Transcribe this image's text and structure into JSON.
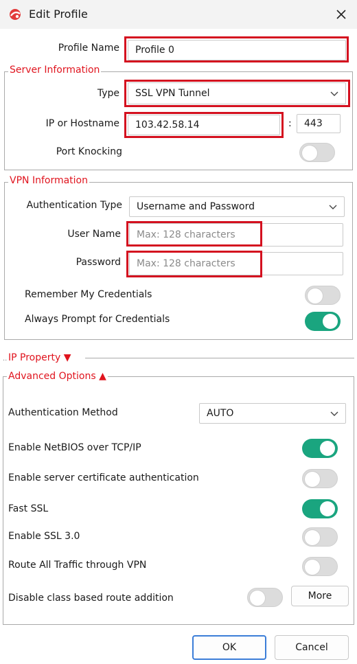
{
  "window": {
    "title": "Edit Profile"
  },
  "profile": {
    "name_label": "Profile Name",
    "name_value": "Profile 0"
  },
  "server": {
    "legend": "Server Information",
    "type_label": "Type",
    "type_value": "SSL VPN Tunnel",
    "host_label": "IP or Hostname",
    "host_value": "103.42.58.14",
    "port_sep": ":",
    "port_value": "443",
    "knock_label": "Port Knocking",
    "knock_on": false
  },
  "vpn": {
    "legend": "VPN Information",
    "auth_type_label": "Authentication Type",
    "auth_type_value": "Username and Password",
    "user_label": "User Name",
    "user_placeholder": "Max: 128 characters",
    "pass_label": "Password",
    "pass_placeholder": "Max: 128 characters",
    "remember_label": "Remember My Credentials",
    "remember_on": false,
    "prompt_label": "Always Prompt for Credentials",
    "prompt_on": true
  },
  "ip_property": {
    "label": "IP Property",
    "arrow": "▼"
  },
  "advanced": {
    "label": "Advanced Options",
    "arrow": "▲",
    "auth_method_label": "Authentication Method",
    "auth_method_value": "AUTO",
    "netbios_label": "Enable NetBIOS over TCP/IP",
    "netbios_on": true,
    "cert_label": "Enable server certificate authentication",
    "cert_on": false,
    "fastssl_label": "Fast SSL",
    "fastssl_on": true,
    "ssl3_label": "Enable SSL 3.0",
    "ssl3_on": false,
    "route_label": "Route All Traffic through VPN",
    "route_on": false,
    "classroute_label": "Disable class based route addition",
    "classroute_on": false,
    "more_label": "More"
  },
  "buttons": {
    "ok": "OK",
    "cancel": "Cancel"
  },
  "colors": {
    "accent_on": "#1aa57f",
    "legend_red": "#e0141e",
    "highlight_red": "#d4101f",
    "primary_border": "#3b7dd8"
  },
  "icons": {
    "app": "app-logo-icon",
    "close": "close-icon",
    "chevron": "chevron-down-icon"
  }
}
